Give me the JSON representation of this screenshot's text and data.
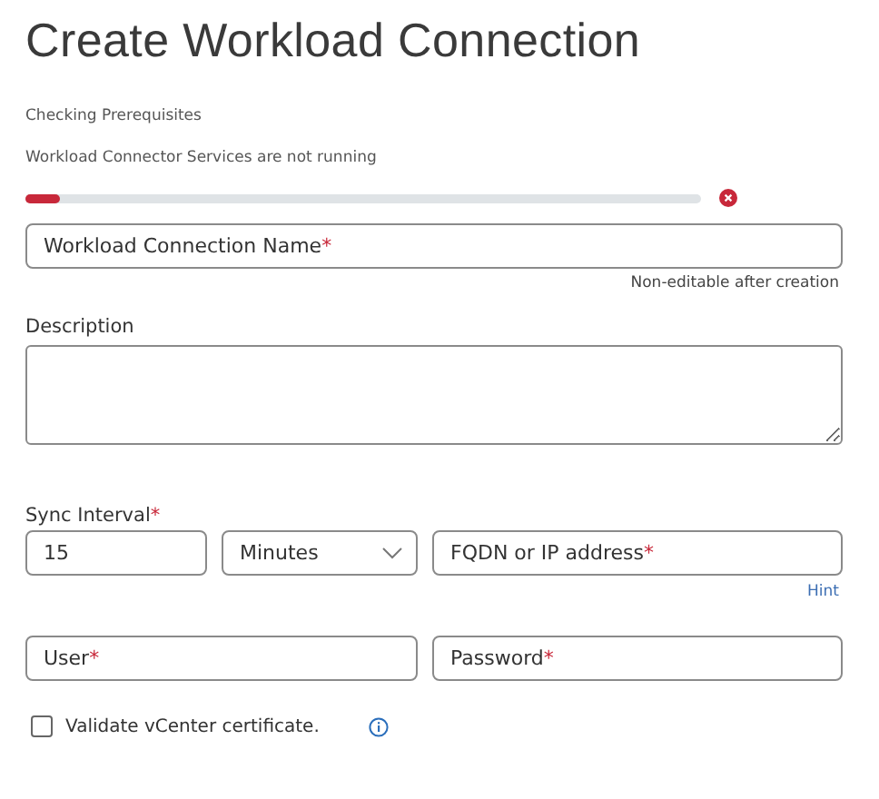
{
  "title": "Create Workload Connection",
  "status": {
    "heading": "Checking Prerequisites",
    "message": "Workload Connector Services are not running",
    "level": 0.05,
    "error": true
  },
  "name_field": {
    "placeholder": "Workload Connection Name",
    "required_mark": "*",
    "note": "Non-editable after creation"
  },
  "description": {
    "label": "Description"
  },
  "sync_interval": {
    "label": "Sync Interval",
    "required_mark": "*",
    "value": "15",
    "unit": "Minutes"
  },
  "address_field": {
    "placeholder": "FQDN or IP address",
    "required_mark": "*",
    "link": "Hint"
  },
  "user_field": {
    "placeholder": "User",
    "required_mark": "*"
  },
  "password_field": {
    "placeholder": "Password",
    "required_mark": "*"
  },
  "validate_certificate": {
    "label": "Validate vCenter certificate.",
    "checked": false
  }
}
